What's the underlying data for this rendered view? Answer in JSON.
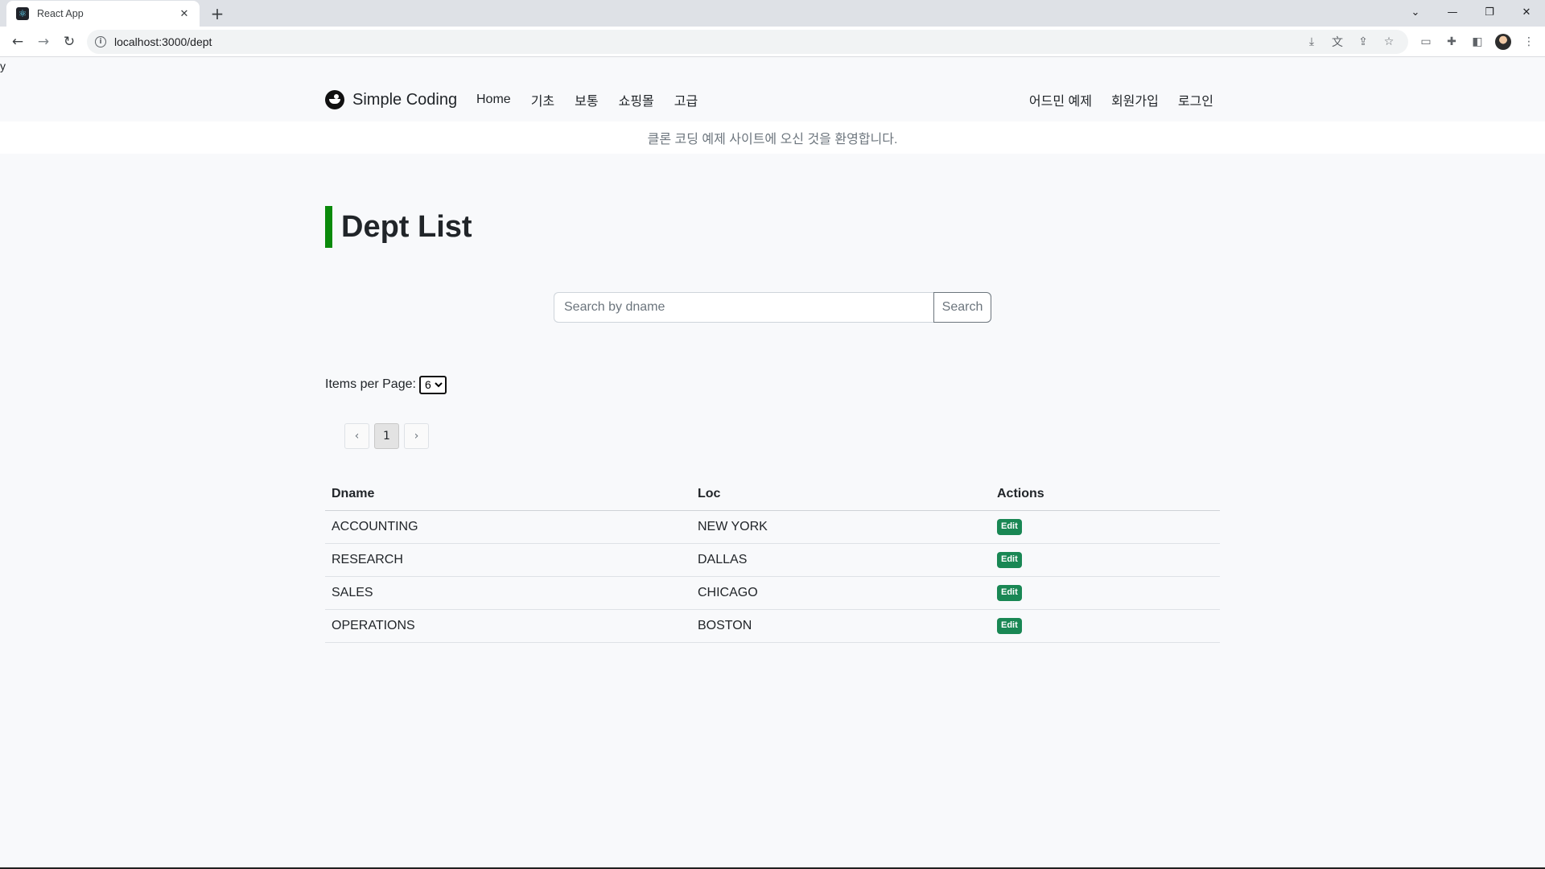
{
  "browser": {
    "tab_title": "React App",
    "tab_close": "✕",
    "new_tab": "+",
    "url": "localhost:3000/dept",
    "icons": {
      "back": "back-arrow-icon",
      "forward": "forward-arrow-icon",
      "reload": "reload-icon",
      "info": "info-icon",
      "minimize": "minimize-icon",
      "maximize": "restore-icon",
      "close": "close-icon"
    }
  },
  "page": {
    "stray_text": "y",
    "brand": "Simple Coding",
    "nav_left": [
      "Home",
      "기초",
      "보통",
      "쇼핑몰",
      "고급"
    ],
    "nav_right": [
      "어드민 예제",
      "회원가입",
      "로그인"
    ],
    "welcome": "클론 코딩 예제 사이트에 오신 것을 환영합니다.",
    "title": "Dept List",
    "search": {
      "placeholder": "Search by dname",
      "button": "Search"
    },
    "items_per_page": {
      "label": "Items per Page:",
      "selected": "6"
    },
    "pagination": {
      "current": "1"
    },
    "table": {
      "headers": [
        "Dname",
        "Loc",
        "Actions"
      ],
      "action_label": "Edit",
      "rows": [
        {
          "dname": "ACCOUNTING",
          "loc": "NEW YORK"
        },
        {
          "dname": "RESEARCH",
          "loc": "DALLAS"
        },
        {
          "dname": "SALES",
          "loc": "CHICAGO"
        },
        {
          "dname": "OPERATIONS",
          "loc": "BOSTON"
        }
      ]
    }
  },
  "colors": {
    "accent_bar": "#0b8a0b",
    "edit_button": "#198754",
    "tab_strip": "#dee1e6"
  }
}
